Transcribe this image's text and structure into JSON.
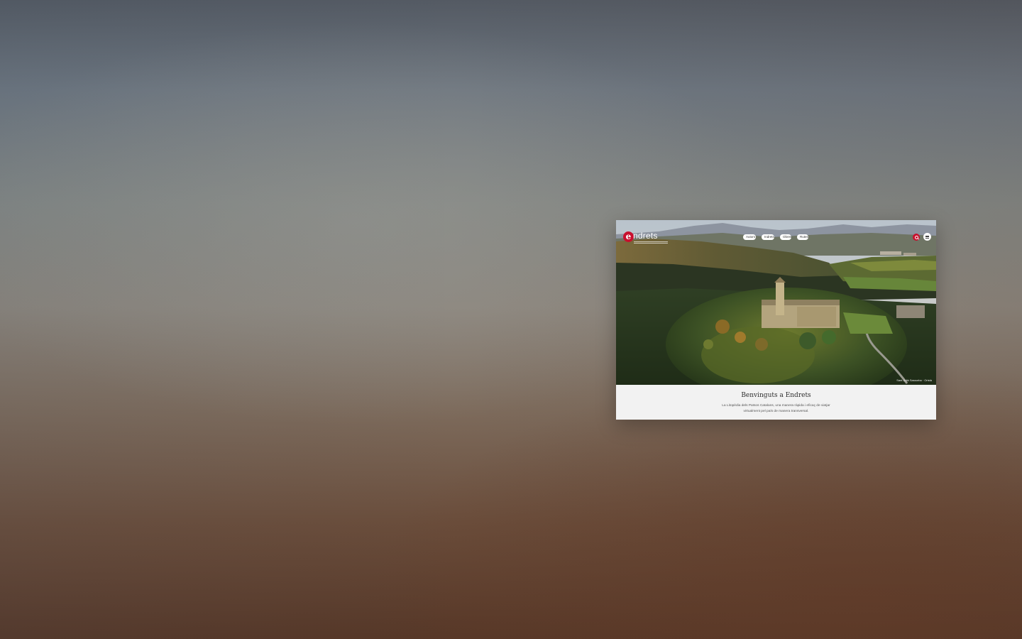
{
  "site": {
    "logo_letter": "e",
    "logo_word": "ndrets",
    "brand_color": "#c8102e"
  },
  "nav": {
    "items": [
      {
        "label": "Autors"
      },
      {
        "label": "Indrets"
      },
      {
        "label": "Obres"
      },
      {
        "label": "Rutes"
      }
    ],
    "search_icon": "search-icon",
    "menu_icon": "hamburger-icon"
  },
  "hero": {
    "caption": "Sant Julià Sassorba · Oristà"
  },
  "welcome": {
    "title": "Benvinguts a Endrets",
    "text": "La Litopèdia dels Països Catalans, una manera ràpida i eficaç de viatjar virtualment pel país de manera transversal."
  }
}
